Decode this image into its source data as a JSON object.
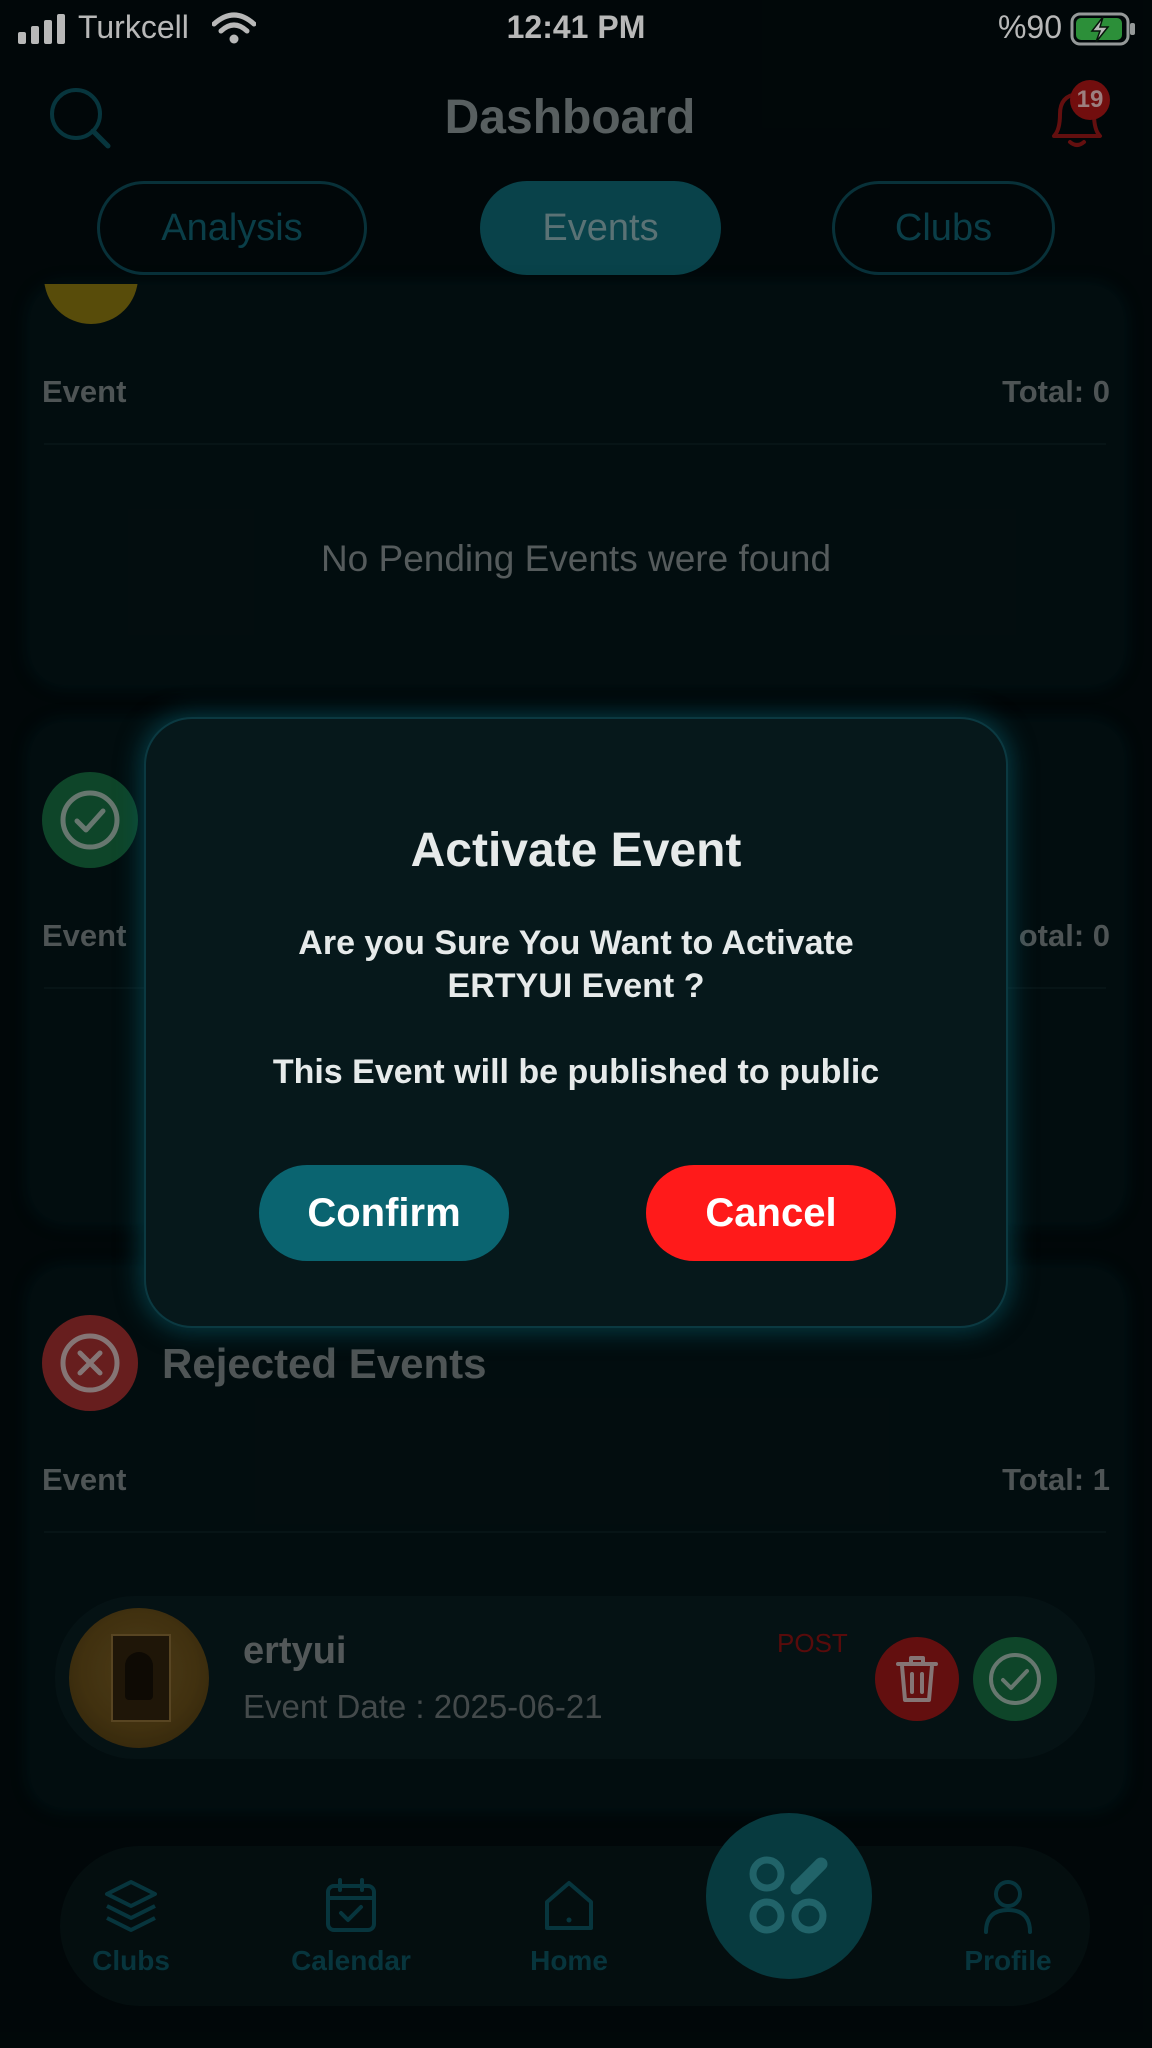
{
  "status_bar": {
    "carrier": "Turkcell",
    "time": "12:41 PM",
    "battery": "%90"
  },
  "header": {
    "title": "Dashboard",
    "notification_count": "19"
  },
  "tabs": [
    {
      "label": "Analysis"
    },
    {
      "label": "Events"
    },
    {
      "label": "Clubs"
    }
  ],
  "pending": {
    "col_event": "Event",
    "total": "Total: 0",
    "empty": "No Pending Events were found"
  },
  "active": {
    "col_event": "Event",
    "total": "otal: 0"
  },
  "rejected": {
    "title": "Rejected Events",
    "col_event": "Event",
    "total": "Total: 1",
    "item": {
      "name": "ertyui",
      "date": "Event Date : 2025-06-21",
      "tag": "POST"
    }
  },
  "modal": {
    "title": "Activate Event",
    "line1": "Are you Sure You Want to Activate",
    "line2": "ERTYUI Event ?",
    "line3": "This Event will be published to public",
    "confirm": "Confirm",
    "cancel": "Cancel"
  },
  "nav": [
    {
      "label": "Clubs",
      "icon": "layers-icon"
    },
    {
      "label": "Calendar",
      "icon": "calendar-icon"
    },
    {
      "label": "Home",
      "icon": "home-icon"
    },
    {
      "label": "Profile",
      "icon": "profile-icon"
    }
  ],
  "colors": {
    "accent": "#0d6a76",
    "danger": "#ff1a1a",
    "success": "#1a8a4a",
    "bg": "#020b0d"
  }
}
